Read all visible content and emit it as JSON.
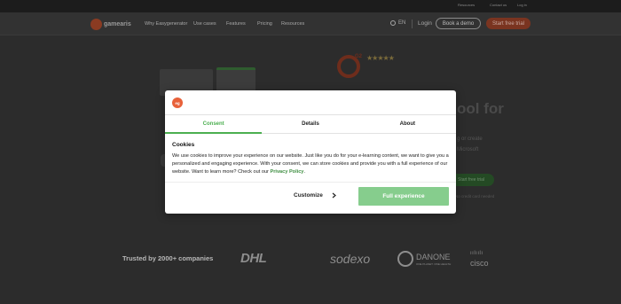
{
  "topbar": {
    "links": [
      "Resources",
      "Contact us",
      "Log in"
    ]
  },
  "brand": {
    "name": "gamearis"
  },
  "nav": {
    "items": [
      "Why Easygenerator",
      "Use cases",
      "Features",
      "Pricing",
      "Resources"
    ],
    "language": "EN",
    "login": "Login",
    "demo": "Book a demo",
    "trial": "Start free trial"
  },
  "hero": {
    "rating_badge": "G2",
    "stars": "★★★★★",
    "title_fragment": "ool for",
    "text1": "g or create",
    "text2": "Microsoft",
    "cta": "Start free trial",
    "cta_sub": "No credit card needed"
  },
  "trusted": {
    "label": "Trusted by 2000+ companies",
    "brands": [
      "DHL",
      "sodexo",
      "DANONE",
      "cisco"
    ],
    "danone_sub": "ONE PLANET. ONE HEALTH"
  },
  "modal": {
    "logo": "eg",
    "tabs": [
      "Consent",
      "Details",
      "About"
    ],
    "active_tab": "Consent",
    "heading": "Cookies",
    "body": "We use cookies to improve your experience on our website. Just like you do for your e-learning content, we want to give you a personalized and engaging experience. With your consent, we can store cookies and provide you with a full experience of our website. Want to learn more? Check out our ",
    "policy_link": "Privacy Policy",
    "body_end": ".",
    "customize": "Customize",
    "full": "Full experience",
    "accent": "#4caf50"
  }
}
